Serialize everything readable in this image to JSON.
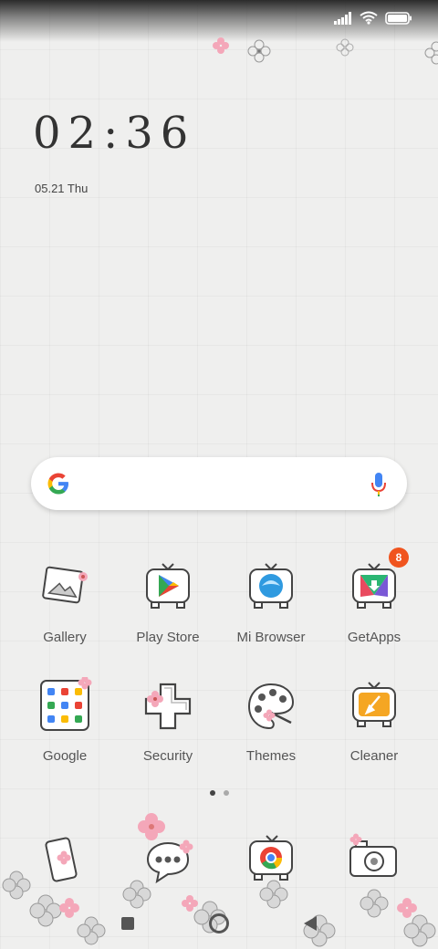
{
  "status_bar": {
    "icons": [
      "signal-icon",
      "wifi-icon",
      "battery-icon"
    ]
  },
  "lock_widget": {
    "time": "02:36",
    "date": "05.21 Thu"
  },
  "search_bar": {
    "icons": [
      "google-logo-icon",
      "microphone-icon"
    ]
  },
  "apps": [
    {
      "label": "Gallery",
      "icon": "gallery-icon"
    },
    {
      "label": "Play Store",
      "icon": "play-store-icon"
    },
    {
      "label": "Mi Browser",
      "icon": "mi-browser-icon"
    },
    {
      "label": "GetApps",
      "icon": "getapps-icon",
      "badge": "8"
    },
    {
      "label": "Google",
      "icon": "google-folder-icon"
    },
    {
      "label": "Security",
      "icon": "security-icon"
    },
    {
      "label": "Themes",
      "icon": "themes-icon"
    },
    {
      "label": "Cleaner",
      "icon": "cleaner-icon"
    }
  ],
  "page_indicator": {
    "pages": 2,
    "current": 1
  },
  "dock": [
    "phone-icon",
    "messages-icon",
    "chrome-icon",
    "camera-icon"
  ],
  "navbar": [
    "recents-button",
    "home-button",
    "back-button"
  ],
  "colors": {
    "badge": "#f0541e",
    "text": "#555555",
    "accent_pink": "#f4a7b9"
  }
}
